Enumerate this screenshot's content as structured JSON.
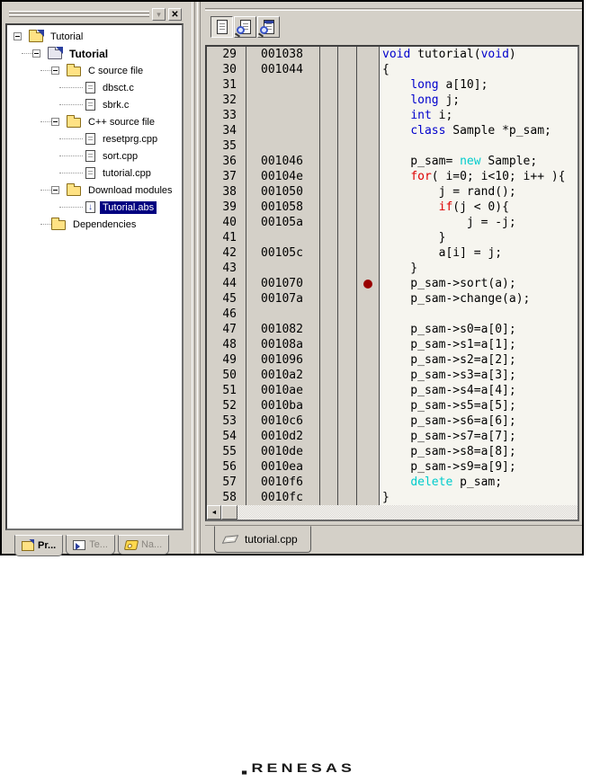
{
  "colors": {
    "keyword": "#0000cc",
    "control": "#dd0000",
    "alloc": "#00cccc",
    "breakpoint": "#990000",
    "selection_bg": "#000080"
  },
  "icons": {
    "panel_menu": "▾",
    "panel_close": "✕",
    "scroll_left": "◄"
  },
  "workspace": {
    "tree": {
      "items": [
        {
          "depth": 0,
          "icon": "workspace",
          "label": "Tutorial",
          "expander": true
        },
        {
          "depth": 1,
          "icon": "project",
          "label": "Tutorial",
          "expander": true,
          "bold": true
        },
        {
          "depth": 2,
          "icon": "folder",
          "label": "C source file",
          "expander": true
        },
        {
          "depth": 3,
          "icon": "file",
          "label": "dbsct.c"
        },
        {
          "depth": 3,
          "icon": "file",
          "label": "sbrk.c"
        },
        {
          "depth": 2,
          "icon": "folder",
          "label": "C++ source file",
          "expander": true
        },
        {
          "depth": 3,
          "icon": "file",
          "label": "resetprg.cpp"
        },
        {
          "depth": 3,
          "icon": "file",
          "label": "sort.cpp"
        },
        {
          "depth": 3,
          "icon": "file",
          "label": "tutorial.cpp"
        },
        {
          "depth": 2,
          "icon": "folder",
          "label": "Download modules",
          "expander": true
        },
        {
          "depth": 3,
          "icon": "download",
          "label": "Tutorial.abs",
          "selected": true,
          "download_glyph": "↓"
        },
        {
          "depth": 2,
          "icon": "folder",
          "label": "Dependencies"
        }
      ]
    },
    "tabs": [
      {
        "label": "Pr...",
        "icon": "projects",
        "active": true
      },
      {
        "label": "Te...",
        "icon": "templates",
        "active": false
      },
      {
        "label": "Na...",
        "icon": "navigation",
        "active": false
      }
    ]
  },
  "editor": {
    "toolbar": [
      {
        "name": "source-view-button",
        "icon": "source",
        "pressed": true
      },
      {
        "name": "disassembly-view-button",
        "icon": "disassembly",
        "pressed": false
      },
      {
        "name": "mixed-view-button",
        "icon": "mixed",
        "pressed": false
      }
    ],
    "tab_label": "tutorial.cpp",
    "lines": [
      {
        "n": 29,
        "addr": "001038",
        "bp": false,
        "code": [
          [
            "k",
            "void"
          ],
          [
            "p",
            " tutorial("
          ],
          [
            "k",
            "void"
          ],
          [
            "p",
            ")"
          ]
        ]
      },
      {
        "n": 30,
        "addr": "001044",
        "bp": false,
        "code": [
          [
            "p",
            "{"
          ]
        ]
      },
      {
        "n": 31,
        "addr": "",
        "bp": false,
        "code": [
          [
            "p",
            "    "
          ],
          [
            "k",
            "long"
          ],
          [
            "p",
            " a[10];"
          ]
        ]
      },
      {
        "n": 32,
        "addr": "",
        "bp": false,
        "code": [
          [
            "p",
            "    "
          ],
          [
            "k",
            "long"
          ],
          [
            "p",
            " j;"
          ]
        ]
      },
      {
        "n": 33,
        "addr": "",
        "bp": false,
        "code": [
          [
            "p",
            "    "
          ],
          [
            "k",
            "int"
          ],
          [
            "p",
            " i;"
          ]
        ]
      },
      {
        "n": 34,
        "addr": "",
        "bp": false,
        "code": [
          [
            "p",
            "    "
          ],
          [
            "k",
            "class"
          ],
          [
            "p",
            " Sample *p_sam;"
          ]
        ]
      },
      {
        "n": 35,
        "addr": "",
        "bp": false,
        "code": []
      },
      {
        "n": 36,
        "addr": "001046",
        "bp": false,
        "code": [
          [
            "p",
            "    p_sam= "
          ],
          [
            "o",
            "new"
          ],
          [
            "p",
            " Sample;"
          ]
        ]
      },
      {
        "n": 37,
        "addr": "00104e",
        "bp": false,
        "code": [
          [
            "p",
            "    "
          ],
          [
            "c",
            "for"
          ],
          [
            "p",
            "( i=0; i<10; i++ ){"
          ]
        ]
      },
      {
        "n": 38,
        "addr": "001050",
        "bp": false,
        "code": [
          [
            "p",
            "        j = rand();"
          ]
        ]
      },
      {
        "n": 39,
        "addr": "001058",
        "bp": false,
        "code": [
          [
            "p",
            "        "
          ],
          [
            "c",
            "if"
          ],
          [
            "p",
            "(j < 0){"
          ]
        ]
      },
      {
        "n": 40,
        "addr": "00105a",
        "bp": false,
        "code": [
          [
            "p",
            "            j = -j;"
          ]
        ]
      },
      {
        "n": 41,
        "addr": "",
        "bp": false,
        "code": [
          [
            "p",
            "        }"
          ]
        ]
      },
      {
        "n": 42,
        "addr": "00105c",
        "bp": false,
        "code": [
          [
            "p",
            "        a[i] = j;"
          ]
        ]
      },
      {
        "n": 43,
        "addr": "",
        "bp": false,
        "code": [
          [
            "p",
            "    }"
          ]
        ]
      },
      {
        "n": 44,
        "addr": "001070",
        "bp": true,
        "code": [
          [
            "p",
            "    p_sam->sort(a);"
          ]
        ]
      },
      {
        "n": 45,
        "addr": "00107a",
        "bp": false,
        "code": [
          [
            "p",
            "    p_sam->change(a);"
          ]
        ]
      },
      {
        "n": 46,
        "addr": "",
        "bp": false,
        "code": []
      },
      {
        "n": 47,
        "addr": "001082",
        "bp": false,
        "code": [
          [
            "p",
            "    p_sam->s0=a[0];"
          ]
        ]
      },
      {
        "n": 48,
        "addr": "00108a",
        "bp": false,
        "code": [
          [
            "p",
            "    p_sam->s1=a[1];"
          ]
        ]
      },
      {
        "n": 49,
        "addr": "001096",
        "bp": false,
        "code": [
          [
            "p",
            "    p_sam->s2=a[2];"
          ]
        ]
      },
      {
        "n": 50,
        "addr": "0010a2",
        "bp": false,
        "code": [
          [
            "p",
            "    p_sam->s3=a[3];"
          ]
        ]
      },
      {
        "n": 51,
        "addr": "0010ae",
        "bp": false,
        "code": [
          [
            "p",
            "    p_sam->s4=a[4];"
          ]
        ]
      },
      {
        "n": 52,
        "addr": "0010ba",
        "bp": false,
        "code": [
          [
            "p",
            "    p_sam->s5=a[5];"
          ]
        ]
      },
      {
        "n": 53,
        "addr": "0010c6",
        "bp": false,
        "code": [
          [
            "p",
            "    p_sam->s6=a[6];"
          ]
        ]
      },
      {
        "n": 54,
        "addr": "0010d2",
        "bp": false,
        "code": [
          [
            "p",
            "    p_sam->s7=a[7];"
          ]
        ]
      },
      {
        "n": 55,
        "addr": "0010de",
        "bp": false,
        "code": [
          [
            "p",
            "    p_sam->s8=a[8];"
          ]
        ]
      },
      {
        "n": 56,
        "addr": "0010ea",
        "bp": false,
        "code": [
          [
            "p",
            "    p_sam->s9=a[9];"
          ]
        ]
      },
      {
        "n": 57,
        "addr": "0010f6",
        "bp": false,
        "code": [
          [
            "p",
            "    "
          ],
          [
            "o",
            "delete"
          ],
          [
            "p",
            " p_sam;"
          ]
        ]
      },
      {
        "n": 58,
        "addr": "0010fc",
        "bp": false,
        "code": [
          [
            "p",
            "}"
          ]
        ]
      }
    ]
  },
  "logo": {
    "text": "RENESAS"
  }
}
